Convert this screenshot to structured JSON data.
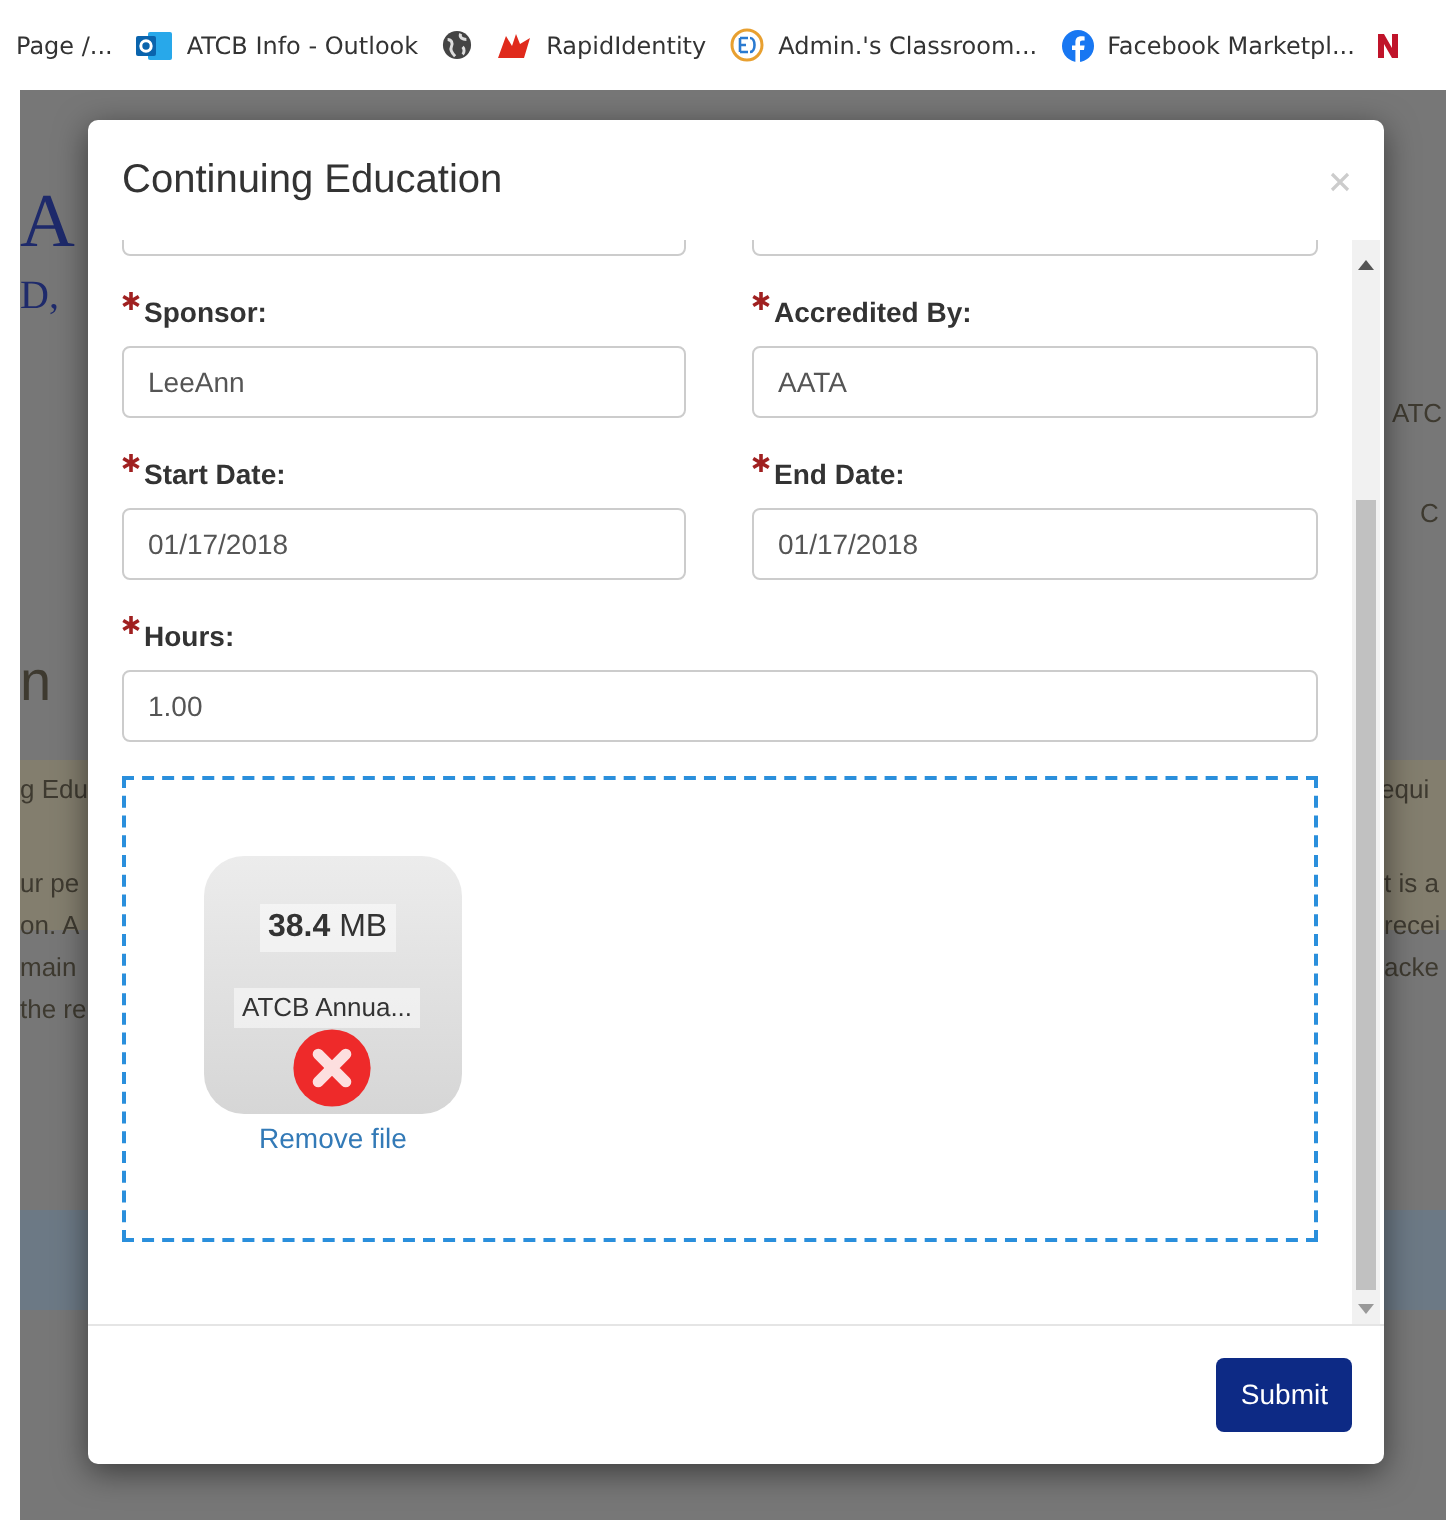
{
  "bookmarks": [
    {
      "kind": "plain",
      "label": "Page /..."
    },
    {
      "kind": "outlook",
      "label": "ATCB Info - Outlook"
    },
    {
      "kind": "globe"
    },
    {
      "kind": "rapid",
      "label": "RapidIdentity"
    },
    {
      "kind": "ed",
      "label": "Admin.'s Classroom..."
    },
    {
      "kind": "facebook",
      "label": "Facebook Marketpl..."
    },
    {
      "kind": "partial"
    }
  ],
  "background": {
    "left": [
      "A",
      "D,",
      "n",
      "g Edu",
      "ur pe",
      "on. A",
      "main",
      "the re"
    ],
    "right": [
      "ATC",
      "C",
      "equi",
      "t is a",
      "recei",
      "acke"
    ]
  },
  "modal": {
    "title": "Continuing Education",
    "fields": [
      {
        "kind": "half",
        "label": "Sponsor:",
        "required": true,
        "value": "LeeAnn"
      },
      {
        "kind": "half",
        "label": "Accredited By:",
        "required": true,
        "value": "AATA"
      },
      {
        "kind": "half",
        "label": "Start Date:",
        "required": true,
        "value": "01/17/2018"
      },
      {
        "kind": "half",
        "label": "End Date:",
        "required": true,
        "value": "01/17/2018"
      },
      {
        "kind": "full",
        "label": "Hours:",
        "required": true,
        "value": "1.00"
      }
    ],
    "file": {
      "size": "**38.4** MB",
      "name": "ATCB Annua...",
      "remove_label": "Remove file"
    },
    "submit": "Submit"
  }
}
